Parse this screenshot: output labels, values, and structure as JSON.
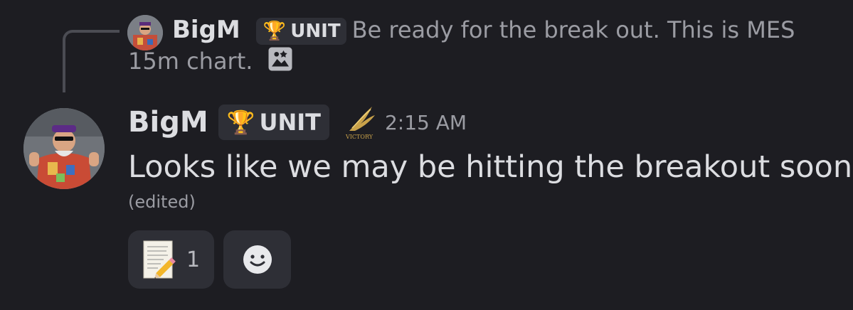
{
  "reply": {
    "author": "BigM",
    "role": "UNIT",
    "text": "Be ready for the break out. This is MES 15m chart.",
    "attachment_icon": "image-icon"
  },
  "message": {
    "author": "BigM",
    "role": "UNIT",
    "badge_icon": "victory-wing-icon",
    "badge_text": "VICTORY",
    "timestamp": "2:15 AM",
    "text": "Looks like we may be hitting the breakout soon.",
    "edited_label": "(edited)"
  },
  "reactions": [
    {
      "emoji": "memo-pencil-emoji",
      "count": "1"
    }
  ],
  "add_reaction_icon": "smiley-icon",
  "colors": {
    "background": "#1d1d22",
    "tag_bg": "#2e2f36",
    "trophy": "#f2c230",
    "muted": "#9b9ca3"
  }
}
